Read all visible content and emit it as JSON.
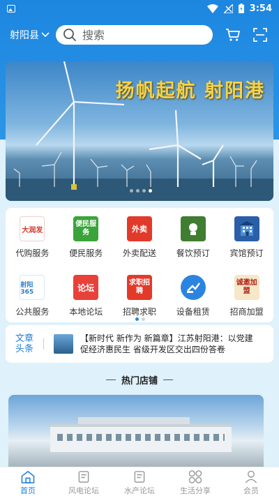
{
  "status_bar": {
    "time": "3:54"
  },
  "header": {
    "city": "射阳县",
    "search_placeholder": "搜索"
  },
  "banner": {
    "title": "扬帆起航 射阳港",
    "dots": 4,
    "active_dot": 3
  },
  "services": [
    {
      "label": "代购服务",
      "icon": "daigou-icon",
      "color": "#ffffff",
      "badge": "大润发"
    },
    {
      "label": "便民服务",
      "icon": "bianmin-icon",
      "color": "#3aa43a",
      "badge": "便民服务"
    },
    {
      "label": "外卖配送",
      "icon": "waimai-icon",
      "color": "#e23a2a",
      "badge": "外卖"
    },
    {
      "label": "餐饮预订",
      "icon": "canyin-icon",
      "color": "#3f7d32",
      "badge": ""
    },
    {
      "label": "宾馆预订",
      "icon": "hotel-icon",
      "color": "#2a5fa8",
      "badge": ""
    },
    {
      "label": "公共服务",
      "icon": "gonggong-icon",
      "color": "#ffffff",
      "badge": "射阳365"
    },
    {
      "label": "本地论坛",
      "icon": "luntan-icon",
      "color": "#e8413a",
      "badge": "论坛"
    },
    {
      "label": "招聘求职",
      "icon": "zhaopin-icon",
      "color": "#e23a2a",
      "badge": "求职招聘"
    },
    {
      "label": "设备租赁",
      "icon": "zulin-icon",
      "color": "#2b84e0",
      "badge": ""
    },
    {
      "label": "招商加盟",
      "icon": "zhaoshang-icon",
      "color": "#f6e7c8",
      "badge": "诚邀加盟"
    }
  ],
  "headline": {
    "tag": "文章头条",
    "text": "【新时代 新作为 新篇章】江苏射阳港：以党建促经济惠民生 省级开发区交出四份答卷"
  },
  "hot_shops": {
    "title": "热门店铺"
  },
  "tabs": [
    {
      "label": "首页",
      "icon": "home-icon",
      "active": true
    },
    {
      "label": "风电论坛",
      "icon": "forum-icon",
      "active": false
    },
    {
      "label": "水产论坛",
      "icon": "forum-icon",
      "active": false
    },
    {
      "label": "生活分享",
      "icon": "grid-icon",
      "active": false
    },
    {
      "label": "会员",
      "icon": "user-icon",
      "active": false
    }
  ],
  "colors": {
    "primary": "#1e7fd8",
    "header_bg": "#1d86e0",
    "page_bg": "#dff1fb"
  }
}
